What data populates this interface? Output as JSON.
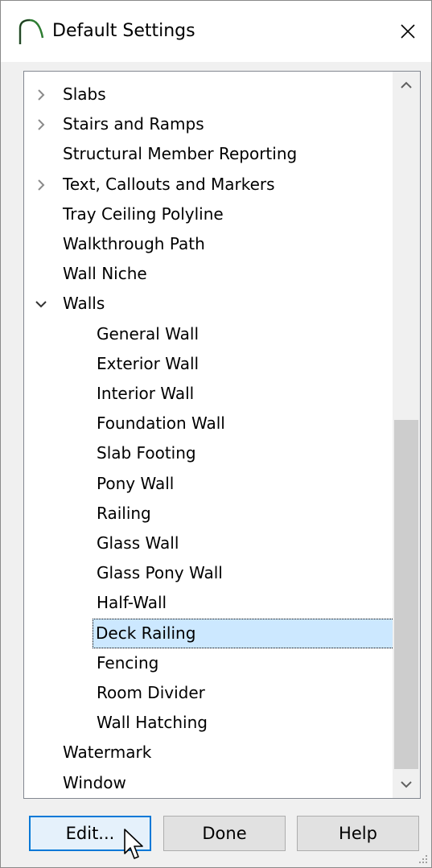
{
  "window": {
    "title": "Default Settings",
    "close_glyph": "✕"
  },
  "tree": {
    "items": [
      {
        "label": "Slabs",
        "level": 0,
        "expander": "collapsed"
      },
      {
        "label": "Stairs and Ramps",
        "level": 0,
        "expander": "collapsed"
      },
      {
        "label": "Structural Member Reporting",
        "level": 0,
        "expander": "none"
      },
      {
        "label": "Text, Callouts and Markers",
        "level": 0,
        "expander": "collapsed"
      },
      {
        "label": "Tray Ceiling Polyline",
        "level": 0,
        "expander": "none"
      },
      {
        "label": "Walkthrough Path",
        "level": 0,
        "expander": "none"
      },
      {
        "label": "Wall Niche",
        "level": 0,
        "expander": "none"
      },
      {
        "label": "Walls",
        "level": 0,
        "expander": "expanded"
      },
      {
        "label": "General Wall",
        "level": 1,
        "expander": "none"
      },
      {
        "label": "Exterior Wall",
        "level": 1,
        "expander": "none"
      },
      {
        "label": "Interior Wall",
        "level": 1,
        "expander": "none"
      },
      {
        "label": "Foundation Wall",
        "level": 1,
        "expander": "none"
      },
      {
        "label": "Slab Footing",
        "level": 1,
        "expander": "none"
      },
      {
        "label": "Pony Wall",
        "level": 1,
        "expander": "none"
      },
      {
        "label": "Railing",
        "level": 1,
        "expander": "none"
      },
      {
        "label": "Glass Wall",
        "level": 1,
        "expander": "none"
      },
      {
        "label": "Glass Pony Wall",
        "level": 1,
        "expander": "none"
      },
      {
        "label": "Half-Wall",
        "level": 1,
        "expander": "none"
      },
      {
        "label": "Deck Railing",
        "level": 1,
        "expander": "none",
        "selected": true
      },
      {
        "label": "Fencing",
        "level": 1,
        "expander": "none"
      },
      {
        "label": "Room Divider",
        "level": 1,
        "expander": "none"
      },
      {
        "label": "Wall Hatching",
        "level": 1,
        "expander": "none"
      },
      {
        "label": "Watermark",
        "level": 0,
        "expander": "none"
      },
      {
        "label": "Window",
        "level": 0,
        "expander": "none"
      }
    ],
    "scroll_position_fraction": 0.92
  },
  "buttons": {
    "edit_label": "Edit...",
    "done_label": "Done",
    "help_label": "Help"
  },
  "colors": {
    "selection": "#cce8ff",
    "default_button_border": "#0078d7",
    "app_icon_stroke": "#2e7d32"
  }
}
